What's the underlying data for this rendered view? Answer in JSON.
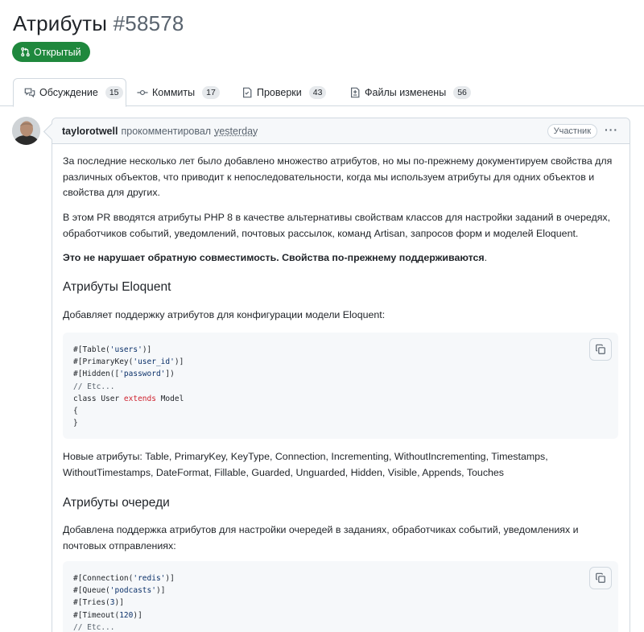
{
  "pr": {
    "title": "Атрибуты",
    "number": "#58578",
    "state": "Открытый",
    "state_color": "#1f883d"
  },
  "tabs": [
    {
      "label": "Обсуждение",
      "count": "15",
      "icon": "comment-discussion-icon",
      "active": true
    },
    {
      "label": "Коммиты",
      "count": "17",
      "icon": "git-commit-icon"
    },
    {
      "label": "Проверки",
      "count": "43",
      "icon": "checklist-icon"
    },
    {
      "label": "Файлы изменены",
      "count": "56",
      "icon": "file-diff-icon"
    }
  ],
  "comment": {
    "author": "taylorotwell",
    "action": "прокомментировал",
    "time": "yesterday",
    "role": "Участник",
    "menu": "···",
    "paragraphs": [
      "За последние несколько лет было добавлено множество атрибутов, но мы по-прежнему документируем свойства для различных объектов, что приводит к непоследовательности, когда мы используем атрибуты для одних объектов и свойства для других.",
      "В этом PR вводятся атрибуты PHP 8 в качестве альтернативы свойствам классов для настройки заданий в очередях, обработчиков событий, уведомлений, почтовых рассылок, команд Artisan, запросов форм и моделей Eloquent.",
      "Это не нарушает обратную совместимость. Свойства по-прежнему поддерживаются",
      "Добавляет поддержку атрибутов для конфигурации модели Eloquent:",
      "Новые атрибуты: Table, PrimaryKey, KeyType, Connection, Incrementing, WithoutIncrementing, Timestamps, WithoutTimestamps, DateFormat, Fillable, Guarded, Unguarded, Hidden, Visible, Appends, Touches",
      "Добавлена поддержка атрибутов для настройки очередей в заданиях, обработчиках событий, уведомлениях и почтовых отправлениях:"
    ],
    "para3_suffix": ".",
    "headings": [
      "Атрибуты Eloquent",
      "Атрибуты очереди"
    ],
    "code1": {
      "l1a": "#[Table(",
      "l1s": "'users'",
      "l1b": ")]",
      "l2a": "#[PrimaryKey(",
      "l2s": "'user_id'",
      "l2b": ")]",
      "l3a": "#[Hidden([",
      "l3s": "'password'",
      "l3b": "])",
      "l4": "// Etc...",
      "l5a": "class User ",
      "l5k": "extends",
      "l5b": " Model",
      "l6": "{",
      "l7": "}"
    },
    "code2": {
      "l1a": "#[Connection(",
      "l1s": "'redis'",
      "l1b": ")]",
      "l2a": "#[Queue(",
      "l2s": "'podcasts'",
      "l2b": ")]",
      "l3a": "#[Tries(",
      "l3s": "3",
      "l3b": ")]",
      "l4a": "#[Timeout(",
      "l4s": "120",
      "l4b": ")]",
      "l5": "// Etc..."
    }
  }
}
